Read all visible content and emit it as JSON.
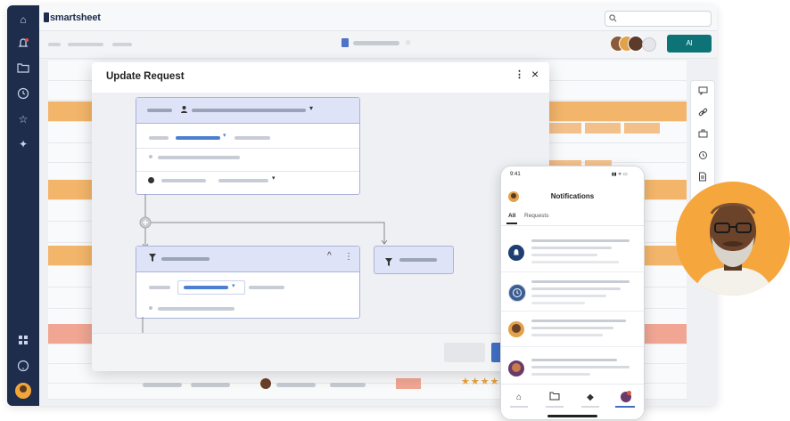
{
  "app": {
    "brand": "smartsheet",
    "share_label": "Al"
  },
  "modal": {
    "title": "Update Request",
    "more_label": "⋮",
    "close_label": "×"
  },
  "phone": {
    "time": "9:41",
    "status": "▮▮ ᯤ ▭",
    "title": "Notifications",
    "tabs": [
      "All",
      "Requests"
    ]
  },
  "grid": {
    "rating": "★★★★"
  },
  "colors": {
    "nav": "#1f2d4d",
    "accent_orange": "#f3b56a",
    "accent_salmon": "#f0a693",
    "share": "#0d7377",
    "card_border": "#aab3d9"
  },
  "icons": {
    "nav": [
      "home-icon",
      "notification-icon",
      "folder-icon",
      "clock-icon",
      "star-icon",
      "sparkle-icon",
      "apps-icon",
      "help-icon",
      "user-avatar"
    ],
    "rail": [
      "comment-icon",
      "link-icon",
      "briefcase-icon",
      "history-icon",
      "document-icon"
    ],
    "phone_tabs": [
      "home-icon",
      "folder-icon",
      "diamond-icon",
      "avatar-icon"
    ]
  }
}
